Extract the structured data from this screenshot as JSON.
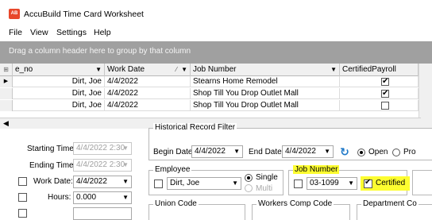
{
  "app": {
    "icon_text": "AB",
    "title": "AccuBuild Time Card Worksheet"
  },
  "menu": {
    "items": [
      "File",
      "View",
      "Settings",
      "Help"
    ]
  },
  "group_panel": {
    "hint": "Drag a column header here to group by that column"
  },
  "grid": {
    "columns": [
      {
        "label": "e_no"
      },
      {
        "label": "Work Date"
      },
      {
        "label": "Job Number"
      },
      {
        "label": "CertifiedPayroll"
      }
    ],
    "rows": [
      {
        "e_no": "Dirt, Joe",
        "work_date": "4/4/2022",
        "job_number": "Stearns Home Remodel",
        "certified": true
      },
      {
        "e_no": "Dirt, Joe",
        "work_date": "4/4/2022",
        "job_number": "Shop Till You Drop Outlet Mall",
        "certified": true
      },
      {
        "e_no": "Dirt, Joe",
        "work_date": "4/4/2022",
        "job_number": "Shop Till You Drop Outlet Mall",
        "certified": false
      }
    ]
  },
  "form": {
    "starting_time": {
      "label": "Starting Time",
      "value": "4/4/2022 2:30"
    },
    "ending_time": {
      "label": "Ending Time",
      "value": "4/4/2022 2:30"
    },
    "work_date": {
      "label": "Work Date:",
      "value": "4/4/2022"
    },
    "hours": {
      "label": "Hours:",
      "value": "0.000"
    },
    "historical": {
      "legend": "Historical Record Filter",
      "begin_label": "Begin Date",
      "begin_value": "4/4/2022",
      "end_label": "End Date:",
      "end_value": "4/4/2022",
      "open_label": "Open",
      "other_label": "Pro"
    },
    "employee": {
      "legend": "Employee",
      "value": "Dirt, Joe",
      "single_label": "Single",
      "multi_label": "Multi"
    },
    "job_number": {
      "legend": "Job Number",
      "value": "03-1099",
      "certified_label": "Certified",
      "certified_checked": true
    },
    "union_code": {
      "legend": "Union Code"
    },
    "workers_comp": {
      "legend": "Workers Comp Code"
    },
    "department": {
      "legend": "Department Co"
    }
  },
  "colors": {
    "highlight": "#fdfd30",
    "group_panel": "#a0a0a0",
    "refresh_icon": "#1e78c8",
    "app_icon": "#e8472b"
  }
}
